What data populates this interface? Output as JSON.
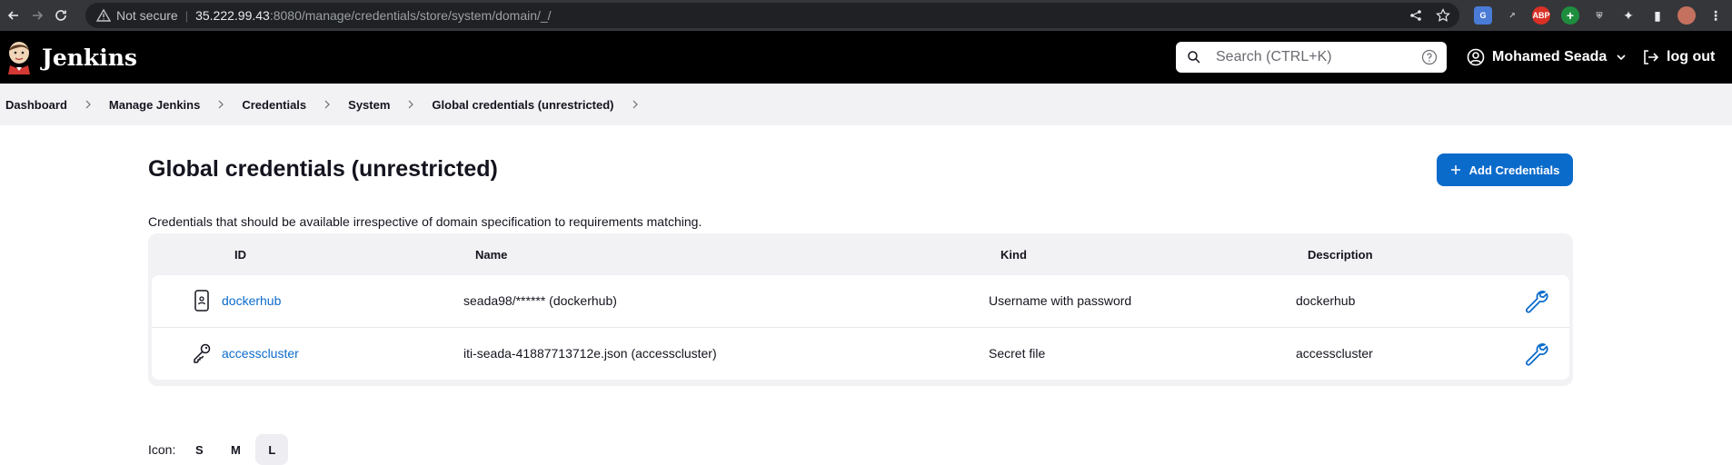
{
  "browser": {
    "security_label": "Not secure",
    "url_host": "35.222.99.43",
    "url_path": ":8080/manage/credentials/store/system/domain/_/"
  },
  "header": {
    "brand": "Jenkins",
    "search_placeholder": "Search (CTRL+K)",
    "user_name": "Mohamed Seada",
    "logout_label": "log out"
  },
  "breadcrumb": [
    "Dashboard",
    "Manage Jenkins",
    "Credentials",
    "System",
    "Global credentials (unrestricted)"
  ],
  "page": {
    "title": "Global credentials (unrestricted)",
    "add_button": "Add Credentials",
    "description": "Credentials that should be available irrespective of domain specification to requirements matching."
  },
  "table": {
    "headers": {
      "id": "ID",
      "name": "Name",
      "kind": "Kind",
      "description": "Description"
    },
    "rows": [
      {
        "icon": "phone-icon",
        "id": "dockerhub",
        "name": "seada98/****** (dockerhub)",
        "kind": "Username with password",
        "description": "dockerhub"
      },
      {
        "icon": "key-icon",
        "id": "accesscluster",
        "name": "iti-seada-41887713712e.json (accesscluster)",
        "kind": "Secret file",
        "description": "accesscluster"
      }
    ]
  },
  "icon_size": {
    "label": "Icon:",
    "options": [
      "S",
      "M",
      "L"
    ],
    "selected": "L"
  },
  "colors": {
    "accent": "#0b6bcb",
    "header_bg": "#000000",
    "breadcrumb_bg": "#f2f2f5"
  }
}
